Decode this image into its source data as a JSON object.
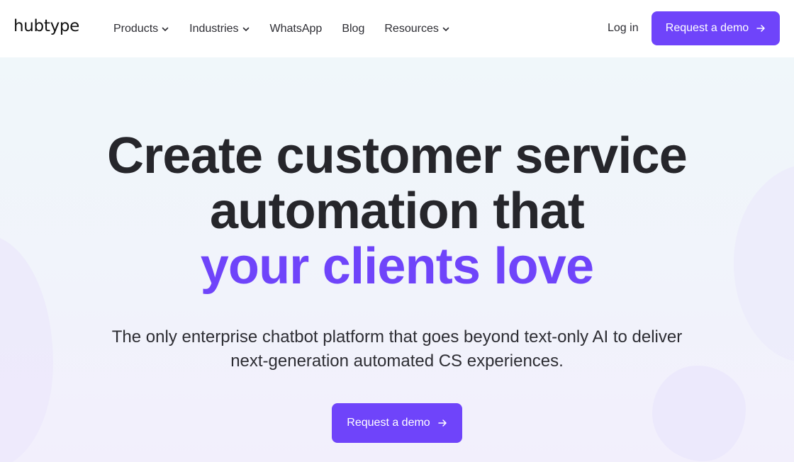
{
  "header": {
    "logo_text": "hubtype",
    "nav": [
      {
        "label": "Products",
        "has_dropdown": true
      },
      {
        "label": "Industries",
        "has_dropdown": true
      },
      {
        "label": "WhatsApp",
        "has_dropdown": false
      },
      {
        "label": "Blog",
        "has_dropdown": false
      },
      {
        "label": "Resources",
        "has_dropdown": true
      }
    ],
    "login_label": "Log in",
    "cta_label": "Request a demo",
    "dropdown_icon": "chevron-down-icon",
    "cta_icon": "arrow-right-icon"
  },
  "hero": {
    "headline_line1": "Create customer service",
    "headline_line2": "automation that",
    "headline_line3": "your clients love",
    "subtitle_line1": "The only enterprise chatbot platform that goes beyond text-only AI to deliver",
    "subtitle_line2": "next-generation automated CS experiences.",
    "cta_label": "Request a demo"
  },
  "colors": {
    "accent": "#6f44fa",
    "text": "#26262b",
    "hero_background": "#f0f5fb"
  }
}
